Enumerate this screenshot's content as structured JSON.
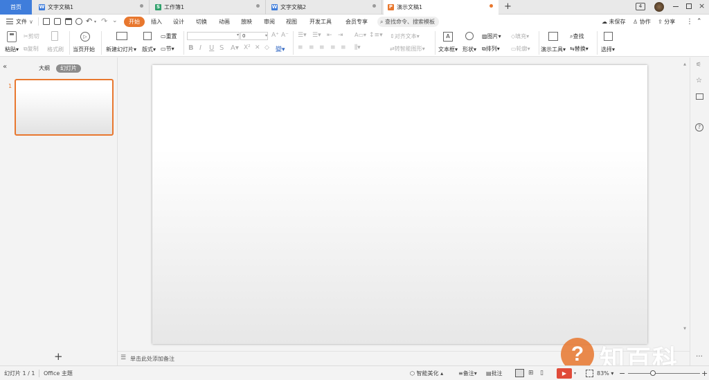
{
  "tabs": [
    {
      "label": "首页"
    },
    {
      "label": "文字文稿1",
      "icon": "W",
      "color": "#3f7ddb"
    },
    {
      "label": "工作簿1",
      "icon": "S",
      "color": "#2ea06a"
    },
    {
      "label": "文字文稿2",
      "icon": "W",
      "color": "#3f7ddb"
    },
    {
      "label": "演示文稿1",
      "icon": "P",
      "color": "#e8772e"
    }
  ],
  "titlebar": {
    "badge": "4"
  },
  "menu": {
    "file": "文件",
    "items": [
      "开始",
      "插入",
      "设计",
      "切换",
      "动画",
      "放映",
      "审阅",
      "视图",
      "开发工具",
      "会员专享"
    ],
    "search": "查找命令、搜索模板",
    "unsaved": "未保存",
    "collab": "协作",
    "share": "分享"
  },
  "ribbon": {
    "paste": "粘贴",
    "cut": "剪切",
    "copy": "复制",
    "format_painter": "格式刷",
    "from_current": "当页开始",
    "new_slide": "新建幻灯片",
    "layout": "版式",
    "section": "节",
    "reset": "重置",
    "font_size": "0",
    "align_text": "对齐文本",
    "smart_art": "转智能图形",
    "textbox": "文本框",
    "shape": "形状",
    "picture": "图片",
    "fill": "填充",
    "arrange": "排列",
    "outline": "轮廓",
    "presentation_tools": "演示工具",
    "find": "查找",
    "replace": "替换",
    "select": "选择"
  },
  "leftpane": {
    "outline_tab": "大纲",
    "slides_tab": "幻灯片",
    "slide_number": "1"
  },
  "notes": {
    "placeholder": "单击此处添加备注"
  },
  "status": {
    "slide_counter": "幻灯片 1 / 1",
    "theme": "Office 主题",
    "beautify": "智能美化",
    "notes": "备注",
    "comments": "批注",
    "zoom": "83%"
  },
  "watermark": {
    "text": "知百科"
  },
  "colors": {
    "accent": "#e8772e",
    "home_tab": "#3f7ddb",
    "play": "#e04b3a"
  }
}
